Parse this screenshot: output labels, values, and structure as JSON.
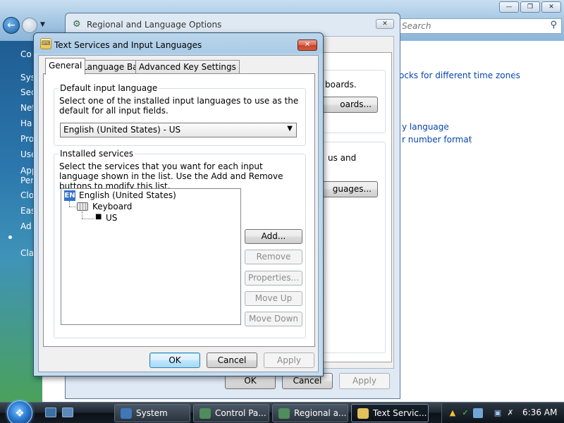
{
  "control_panel": {
    "search_placeholder": "Search",
    "sidebar": [
      "Co",
      "Sys",
      "Sec",
      "Net",
      "Ha",
      "Pro",
      "Use",
      "App",
      "Per",
      "Clo",
      "Eas",
      "Ad",
      "Cla"
    ],
    "links": {
      "time_zones": "ocks for different time zones",
      "display_language": "y language",
      "number_format": "r number format"
    }
  },
  "regional_window": {
    "title": "Regional and Language Options",
    "text_keyboards": "boards.",
    "change_keyboards_button": "oards...",
    "text_menus": "us and",
    "install_languages_button": "guages...",
    "ok": "OK",
    "cancel": "Cancel",
    "apply": "Apply"
  },
  "dialog": {
    "title": "Text Services and Input Languages",
    "tabs": [
      "General",
      "Language Bar",
      "Advanced Key Settings"
    ],
    "default_group": {
      "legend": "Default input language",
      "description": "Select one of the installed input languages to use as the default for all input fields.",
      "selected": "English (United States) - US"
    },
    "installed_group": {
      "legend": "Installed services",
      "description": "Select the services that you want for each input language shown in the list. Use the Add and Remove buttons to modify this list.",
      "tree": {
        "badge": "EN",
        "language": "English (United States)",
        "category": "Keyboard",
        "layout": "US"
      },
      "buttons": {
        "add": "Add...",
        "remove": "Remove",
        "properties": "Properties...",
        "move_up": "Move Up",
        "move_down": "Move Down"
      }
    },
    "ok": "OK",
    "cancel": "Cancel",
    "apply": "Apply"
  },
  "taskbar": {
    "items": [
      "System",
      "Control Pa...",
      "Regional a...",
      "Text Servic..."
    ],
    "clock": "6:36 AM"
  }
}
